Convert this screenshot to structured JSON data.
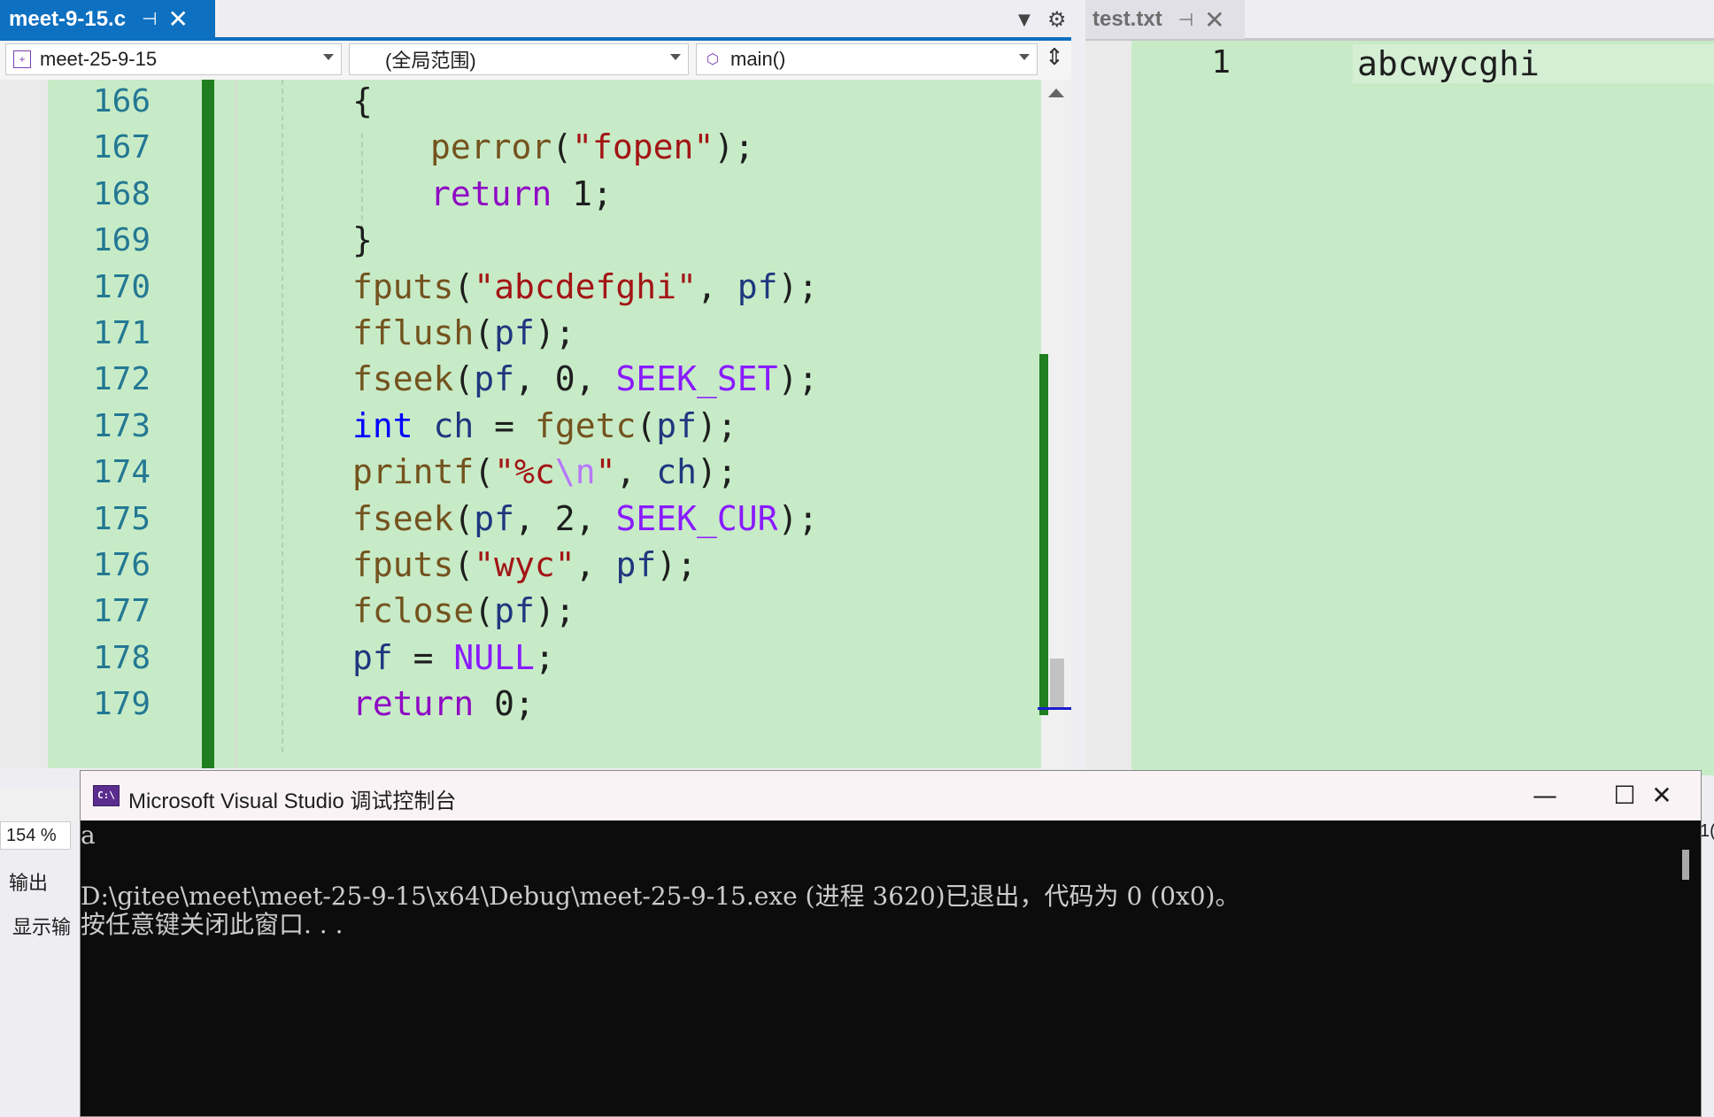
{
  "editor": {
    "active_tab": "meet-9-15.c",
    "pin_icon": "⊣",
    "close_icon": "✕",
    "nav": {
      "project": "meet-25-9-15",
      "scope": "(全局范围)",
      "function": "main()"
    },
    "zoom": "154 %",
    "lines": [
      {
        "num": "166",
        "tokens": [
          {
            "t": "{",
            "c": ""
          }
        ]
      },
      {
        "num": "167",
        "tokens": [
          {
            "t": "perror",
            "c": "fn"
          },
          {
            "t": "(",
            "c": ""
          },
          {
            "t": "\"fopen\"",
            "c": "str"
          },
          {
            "t": ");",
            "c": ""
          }
        ]
      },
      {
        "num": "168",
        "tokens": [
          {
            "t": "return",
            "c": "kwp"
          },
          {
            "t": " 1;",
            "c": ""
          }
        ]
      },
      {
        "num": "169",
        "tokens": [
          {
            "t": "}",
            "c": ""
          }
        ]
      },
      {
        "num": "170",
        "tokens": [
          {
            "t": "fputs",
            "c": "fn"
          },
          {
            "t": "(",
            "c": ""
          },
          {
            "t": "\"abcdefghi\"",
            "c": "str"
          },
          {
            "t": ", ",
            "c": ""
          },
          {
            "t": "pf",
            "c": "var"
          },
          {
            "t": ");",
            "c": ""
          }
        ]
      },
      {
        "num": "171",
        "tokens": [
          {
            "t": "fflush",
            "c": "fn"
          },
          {
            "t": "(",
            "c": ""
          },
          {
            "t": "pf",
            "c": "var"
          },
          {
            "t": ");",
            "c": ""
          }
        ]
      },
      {
        "num": "172",
        "tokens": [
          {
            "t": "fseek",
            "c": "fn"
          },
          {
            "t": "(",
            "c": ""
          },
          {
            "t": "pf",
            "c": "var"
          },
          {
            "t": ", 0, ",
            "c": ""
          },
          {
            "t": "SEEK_SET",
            "c": "mac"
          },
          {
            "t": ");",
            "c": ""
          }
        ]
      },
      {
        "num": "173",
        "tokens": [
          {
            "t": "int",
            "c": "kw"
          },
          {
            "t": " ",
            "c": ""
          },
          {
            "t": "ch",
            "c": "var"
          },
          {
            "t": " = ",
            "c": ""
          },
          {
            "t": "fgetc",
            "c": "fn"
          },
          {
            "t": "(",
            "c": ""
          },
          {
            "t": "pf",
            "c": "var"
          },
          {
            "t": ");",
            "c": ""
          }
        ]
      },
      {
        "num": "174",
        "tokens": [
          {
            "t": "printf",
            "c": "fn"
          },
          {
            "t": "(",
            "c": ""
          },
          {
            "t": "\"%c",
            "c": "str"
          },
          {
            "t": "\\n",
            "c": "esc"
          },
          {
            "t": "\"",
            "c": "str"
          },
          {
            "t": ", ",
            "c": ""
          },
          {
            "t": "ch",
            "c": "var"
          },
          {
            "t": ");",
            "c": ""
          }
        ]
      },
      {
        "num": "175",
        "tokens": [
          {
            "t": "fseek",
            "c": "fn"
          },
          {
            "t": "(",
            "c": ""
          },
          {
            "t": "pf",
            "c": "var"
          },
          {
            "t": ", 2, ",
            "c": ""
          },
          {
            "t": "SEEK_CUR",
            "c": "mac"
          },
          {
            "t": ");",
            "c": ""
          }
        ]
      },
      {
        "num": "176",
        "tokens": [
          {
            "t": "fputs",
            "c": "fn"
          },
          {
            "t": "(",
            "c": ""
          },
          {
            "t": "\"wyc\"",
            "c": "str"
          },
          {
            "t": ", ",
            "c": ""
          },
          {
            "t": "pf",
            "c": "var"
          },
          {
            "t": ");",
            "c": ""
          }
        ]
      },
      {
        "num": "177",
        "tokens": [
          {
            "t": "fclose",
            "c": "fn"
          },
          {
            "t": "(",
            "c": ""
          },
          {
            "t": "pf",
            "c": "var"
          },
          {
            "t": ");",
            "c": ""
          }
        ]
      },
      {
        "num": "178",
        "tokens": [
          {
            "t": "pf",
            "c": "var"
          },
          {
            "t": " = ",
            "c": ""
          },
          {
            "t": "NULL",
            "c": "mac"
          },
          {
            "t": ";",
            "c": ""
          }
        ]
      },
      {
        "num": "179",
        "tokens": [
          {
            "t": "return",
            "c": "kwp"
          },
          {
            "t": " 0;",
            "c": ""
          }
        ]
      }
    ]
  },
  "panel": {
    "output_tab": "输出",
    "output_show": "显示输"
  },
  "right_editor": {
    "tab": "test.txt",
    "line_number": "1",
    "content": "abcwycghi",
    "edge_text": "1("
  },
  "console": {
    "title": "Microsoft Visual Studio 调试控制台",
    "icon_text": "C:\\",
    "lines": [
      "a",
      "",
      "D:\\gitee\\meet\\meet-25-9-15\\x64\\Debug\\meet-25-9-15.exe (进程 3620)已退出，代码为 0 (0x0)。",
      "按任意键关闭此窗口. . ."
    ],
    "minimize": "—",
    "maximize": "☐",
    "close": "✕"
  },
  "colors": {
    "accent": "#0e70c0",
    "editor_bg": "#c7ebc7",
    "change_bar": "#1f7e1f",
    "console_bg": "#0c0c0c"
  }
}
